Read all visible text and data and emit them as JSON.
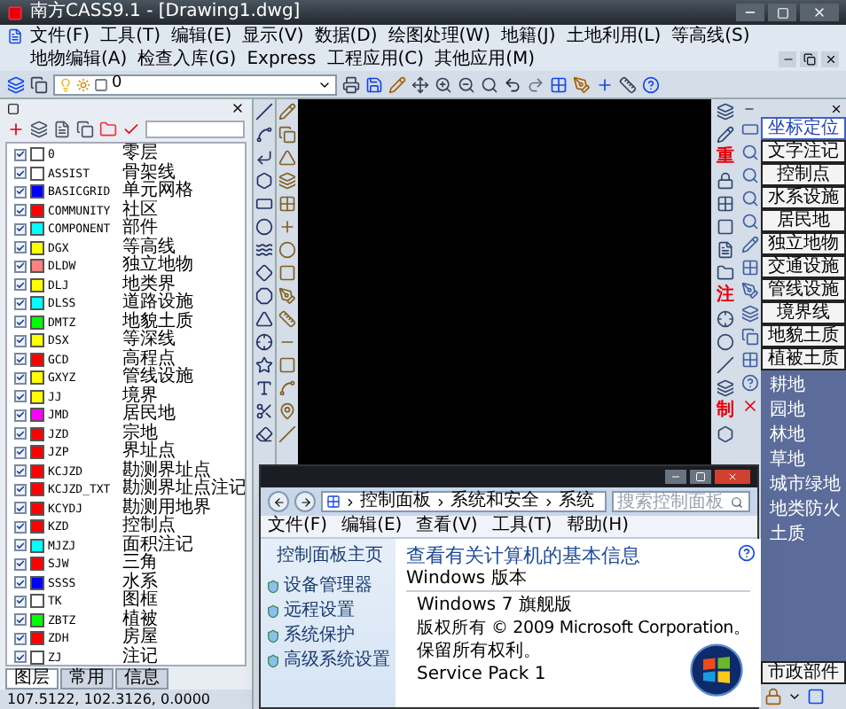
{
  "window": {
    "title": "南方CASS9.1 - [Drawing1.dwg]"
  },
  "menu": [
    "文件(F)",
    "工具(T)",
    "编辑(E)",
    "显示(V)",
    "数据(D)",
    "绘图处理(W)",
    "地籍(J)",
    "土地利用(L)",
    "等高线(S)",
    "地物编辑(A)",
    "检查入库(G)",
    "Express",
    "工程应用(C)",
    "其他应用(M)"
  ],
  "toolbar": {
    "layer": "0"
  },
  "layer_panel": {
    "layers": [
      {
        "name": "0",
        "description": "零层",
        "visible": true,
        "color": "#ffffff"
      },
      {
        "name": "ASSIST",
        "description": "骨架线",
        "visible": true,
        "color": "#ffffff"
      },
      {
        "name": "BASICGRID",
        "description": "单元网格",
        "visible": true,
        "color": "#0000ff"
      },
      {
        "name": "COMMUNITY",
        "description": "社区",
        "visible": true,
        "color": "#ff0000"
      },
      {
        "name": "COMPONENT",
        "description": "部件",
        "visible": true,
        "color": "#00ffff"
      },
      {
        "name": "DGX",
        "description": "等高线",
        "visible": true,
        "color": "#ffff00"
      },
      {
        "name": "DLDW",
        "description": "独立地物",
        "visible": true,
        "color": "#ff8080"
      },
      {
        "name": "DLJ",
        "description": "地类界",
        "visible": true,
        "color": "#ffff00"
      },
      {
        "name": "DLSS",
        "description": "道路设施",
        "visible": true,
        "color": "#00ffff"
      },
      {
        "name": "DMTZ",
        "description": "地貌土质",
        "visible": true,
        "color": "#00ff00"
      },
      {
        "name": "DSX",
        "description": "等深线",
        "visible": true,
        "color": "#ffff00"
      },
      {
        "name": "GCD",
        "description": "高程点",
        "visible": true,
        "color": "#ff0000"
      },
      {
        "name": "GXYZ",
        "description": "管线设施",
        "visible": true,
        "color": "#ffff00"
      },
      {
        "name": "JJ",
        "description": "境界",
        "visible": true,
        "color": "#ffff00"
      },
      {
        "name": "JMD",
        "description": "居民地",
        "visible": true,
        "color": "#ff00ff"
      },
      {
        "name": "JZD",
        "description": "宗地",
        "visible": true,
        "color": "#ff0000"
      },
      {
        "name": "JZP",
        "description": "界址点",
        "visible": true,
        "color": "#ff0000"
      },
      {
        "name": "KCJZD",
        "description": "勘测界址点",
        "visible": true,
        "color": "#ff0000"
      },
      {
        "name": "KCJZD_TXT",
        "description": "勘测界址点注记",
        "visible": true,
        "color": "#ff0000"
      },
      {
        "name": "KCYDJ",
        "description": "勘测用地界",
        "visible": true,
        "color": "#ff0000"
      },
      {
        "name": "KZD",
        "description": "控制点",
        "visible": true,
        "color": "#ff0000"
      },
      {
        "name": "MJZJ",
        "description": "面积注记",
        "visible": true,
        "color": "#00ffff"
      },
      {
        "name": "SJW",
        "description": "三角",
        "visible": true,
        "color": "#ff0000"
      },
      {
        "name": "SSSS",
        "description": "水系",
        "visible": true,
        "color": "#0000ff"
      },
      {
        "name": "TK",
        "description": "图框",
        "visible": true,
        "color": "#ffffff"
      },
      {
        "name": "ZBTZ",
        "description": "植被",
        "visible": true,
        "color": "#00ff00"
      },
      {
        "name": "ZDH",
        "description": "房屋",
        "visible": true,
        "color": "#ff0000"
      },
      {
        "name": "ZJ",
        "description": "注记",
        "visible": true,
        "color": "#ffffff"
      }
    ],
    "tabs": [
      {
        "label": "图层",
        "selected": true
      },
      {
        "label": "常用",
        "selected": false
      },
      {
        "label": "信息",
        "selected": false
      }
    ],
    "coordinates": "107.5122, 102.3126, 0.0000"
  },
  "side_glyphs": [
    "重",
    "注",
    "制"
  ],
  "code_panel": {
    "buttons": [
      {
        "label": "坐标定位",
        "selected": true
      },
      {
        "label": "文字注记",
        "selected": false
      },
      {
        "label": "控制点",
        "selected": false
      },
      {
        "label": "水系设施",
        "selected": false
      },
      {
        "label": "居民地",
        "selected": false
      },
      {
        "label": "独立地物",
        "selected": false
      },
      {
        "label": "交通设施",
        "selected": false
      },
      {
        "label": "管线设施",
        "selected": false
      },
      {
        "label": "境界线",
        "selected": false
      },
      {
        "label": "地貌土质",
        "selected": false
      },
      {
        "label": "植被土质",
        "selected": false
      }
    ],
    "categories": [
      "耕地",
      "园地",
      "林地",
      "草地",
      "城市绿地",
      "地类防火",
      "土质"
    ],
    "footer_button": "市政部件"
  },
  "system_window": {
    "breadcrumb": [
      "控制面板",
      "系统和安全",
      "系统"
    ],
    "search": {
      "placeholder": "搜索控制面板"
    },
    "menu": [
      "文件(F)",
      "编辑(E)",
      "查看(V)",
      "工具(T)",
      "帮助(H)"
    ],
    "home_link": "控制面板主页",
    "links": [
      "设备管理器",
      "远程设置",
      "系统保护",
      "高级系统设置"
    ],
    "heading": "查看有关计算机的基本信息",
    "section": "Windows 版本",
    "edition": "Windows 7 旗舰版",
    "copyright": "版权所有 © 2009 Microsoft Corporation。",
    "rights": "保留所有权利。",
    "service_pack": "Service Pack 1"
  }
}
